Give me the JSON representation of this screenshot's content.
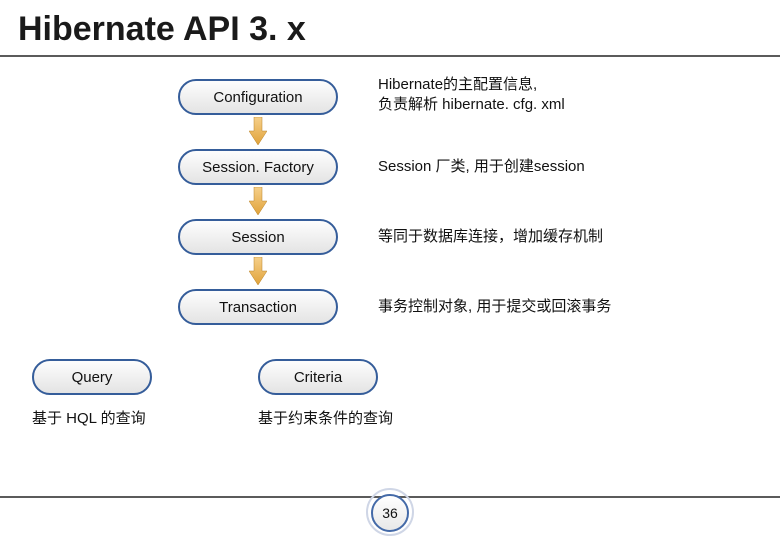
{
  "title": "Hibernate API 3. x",
  "boxes": {
    "configuration": "Configuration",
    "sessionFactory": "Session. Factory",
    "session": "Session",
    "transaction": "Transaction",
    "query": "Query",
    "criteria": "Criteria"
  },
  "descriptions": {
    "configuration_l1": "Hibernate的主配置信息,",
    "configuration_l2": "负责解析 hibernate. cfg. xml",
    "sessionFactory": "Session 厂类, 用于创建session",
    "session": "等同于数据库连接，增加缓存机制",
    "transaction": "事务控制对象, 用于提交或回滚事务",
    "query": "基于 HQL 的查询",
    "criteria": "基于约束条件的查询"
  },
  "pageNumber": "36"
}
